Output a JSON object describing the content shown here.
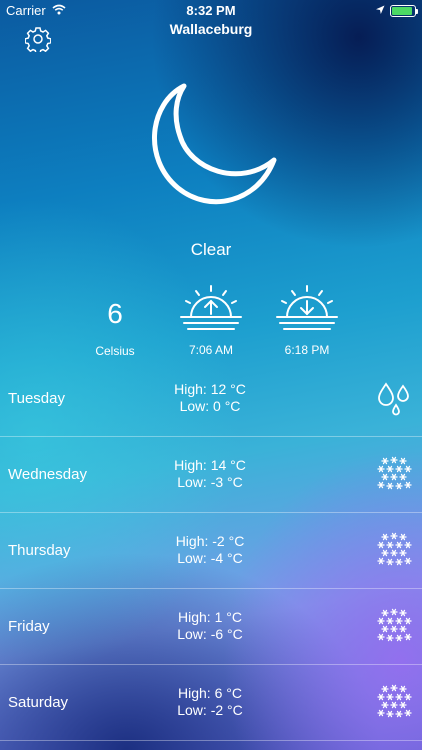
{
  "status_bar": {
    "carrier": "Carrier",
    "time": "8:32 PM",
    "battery_level": 0.9,
    "battery_color": "#4cd964"
  },
  "header": {
    "title": "Wallaceburg",
    "settings_icon": "gear-icon"
  },
  "current": {
    "icon": "moon-icon",
    "condition": "Clear",
    "temperature": "6",
    "unit": "Celsius",
    "sunrise": "7:06 AM",
    "sunset": "6:18 PM"
  },
  "forecast": [
    {
      "day": "Tuesday",
      "high": "High: 12 °C",
      "low": "Low: 0 °C",
      "icon": "raindrops-icon"
    },
    {
      "day": "Wednesday",
      "high": "High: 14 °C",
      "low": "Low: -3 °C",
      "icon": "snow-icon"
    },
    {
      "day": "Thursday",
      "high": "High: -2 °C",
      "low": "Low: -4 °C",
      "icon": "snow-icon"
    },
    {
      "day": "Friday",
      "high": "High: 1 °C",
      "low": "Low: -6 °C",
      "icon": "snow-icon"
    },
    {
      "day": "Saturday",
      "high": "High: 6 °C",
      "low": "Low: -2 °C",
      "icon": "snow-icon"
    }
  ]
}
